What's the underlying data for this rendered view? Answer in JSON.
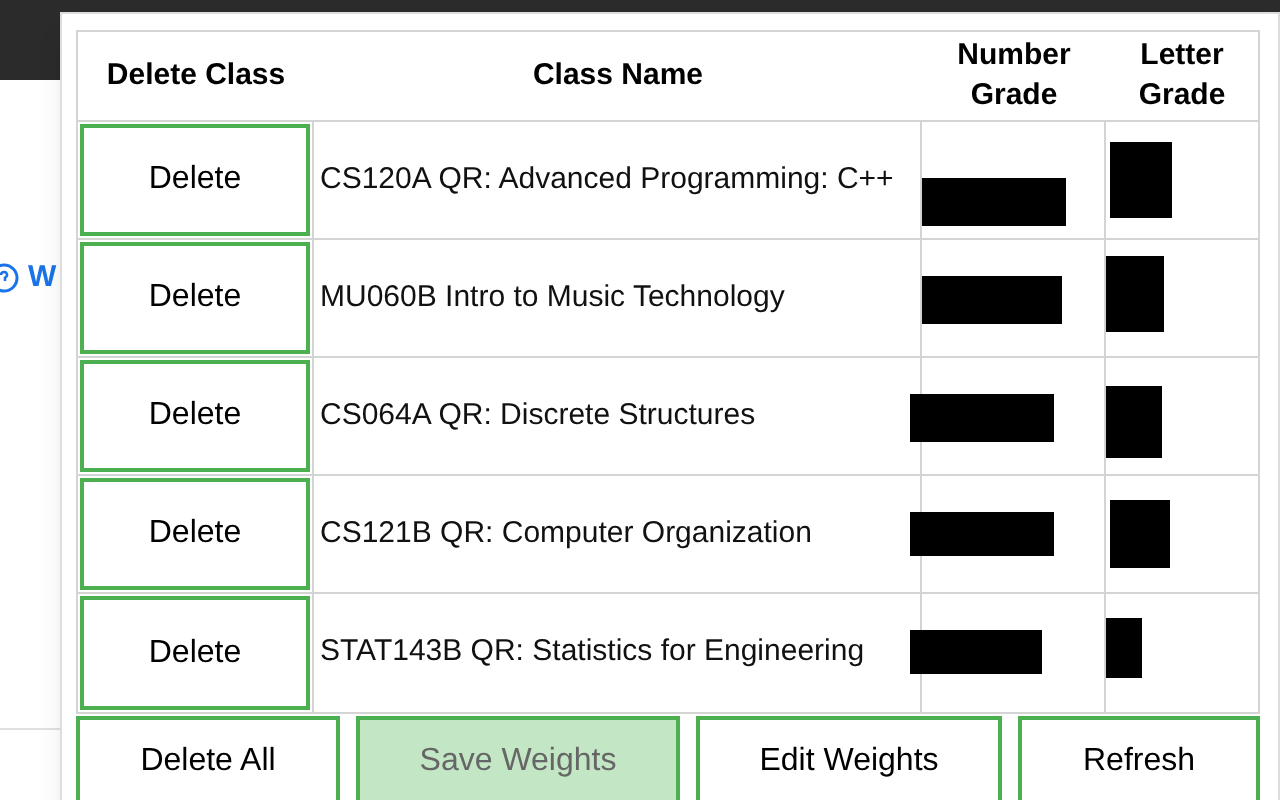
{
  "background_page": {
    "link_text": "W"
  },
  "table": {
    "columns": [
      "Delete Class",
      "Class Name",
      "Number Grade",
      "Letter Grade"
    ],
    "rows": [
      {
        "delete_label": "Delete",
        "class_name": "CS120A QR: Advanced Programming: C++"
      },
      {
        "delete_label": "Delete",
        "class_name": "MU060B Intro to Music Technology"
      },
      {
        "delete_label": "Delete",
        "class_name": "CS064A QR: Discrete Structures"
      },
      {
        "delete_label": "Delete",
        "class_name": "CS121B QR: Computer Organization"
      },
      {
        "delete_label": "Delete",
        "class_name": "STAT143B QR: Statistics for Engineering"
      }
    ]
  },
  "actions": [
    {
      "label": "Delete All",
      "disabled": false
    },
    {
      "label": "Save Weights",
      "disabled": true
    },
    {
      "label": "Edit Weights",
      "disabled": false
    },
    {
      "label": "Refresh",
      "disabled": false
    }
  ]
}
